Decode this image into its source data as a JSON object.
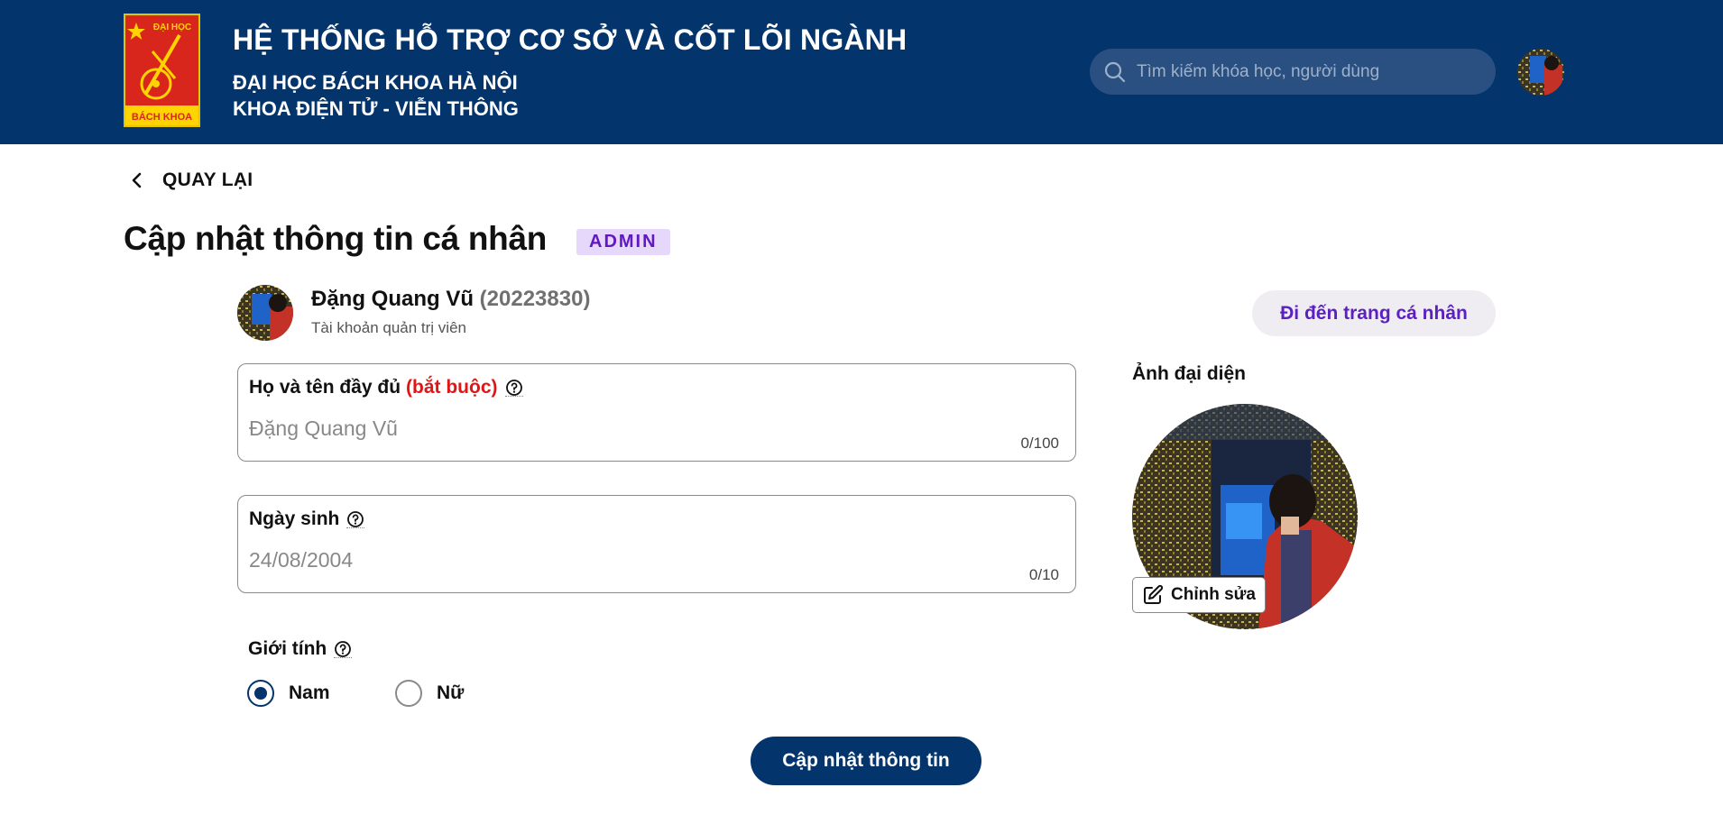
{
  "header": {
    "title": "HỆ THỐNG HỖ TRỢ CƠ SỞ VÀ CỐT LÕI NGÀNH",
    "subtitle1": "ĐẠI HỌC BÁCH KHOA HÀ NỘI",
    "subtitle2": "KHOA ĐIỆN TỬ - VIỄN THÔNG",
    "logo_text_top": "ĐẠI HỌC",
    "logo_text_bottom": "BÁCH KHOA",
    "search_placeholder": "Tìm kiếm khóa học, người dùng"
  },
  "back_label": "QUAY LẠI",
  "page_title": "Cập nhật thông tin cá nhân",
  "badge": "ADMIN",
  "user": {
    "name": "Đặng Quang Vũ",
    "id": "(20223830)",
    "role": "Tài khoản quản trị viên"
  },
  "goto_profile_label": "Đi đến trang cá nhân",
  "fields": {
    "fullname": {
      "label": "Họ và tên đầy đủ",
      "required": "(bắt buộc)",
      "placeholder": "Đặng Quang Vũ",
      "counter": "0/100"
    },
    "birthday": {
      "label": "Ngày sinh",
      "placeholder": "24/08/2004",
      "counter": "0/10"
    }
  },
  "gender": {
    "label": "Giới tính",
    "options": [
      "Nam",
      "Nữ"
    ],
    "selected": "Nam"
  },
  "avatar": {
    "label": "Ảnh đại diện",
    "edit_label": "Chỉnh sửa"
  },
  "submit_label": "Cập nhật thông tin",
  "colors": {
    "header_bg": "#03346b",
    "accent_purple": "#5b1fc2",
    "required_red": "#e01616"
  }
}
